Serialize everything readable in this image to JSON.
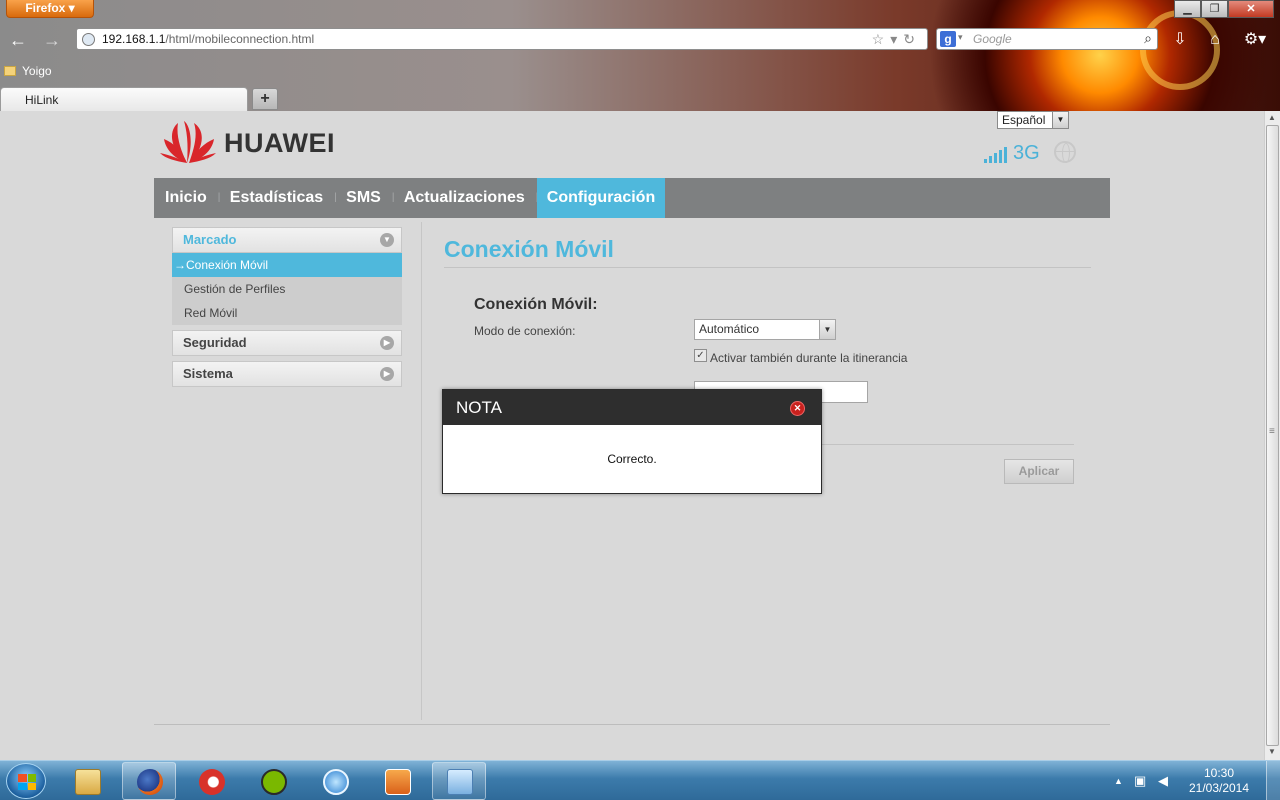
{
  "browser": {
    "app_button": "Firefox",
    "url_host": "192.168.1.1",
    "url_path": "/html/mobileconnection.html",
    "search_placeholder": "Google",
    "bookmarks": [
      "Yoigo"
    ],
    "tabs": [
      {
        "label": "HiLink"
      }
    ],
    "new_tab": "+"
  },
  "page": {
    "language": "Español",
    "brand": "HUAWEI",
    "network_type": "3G",
    "nav": [
      {
        "label": "Inicio"
      },
      {
        "label": "Estadísticas"
      },
      {
        "label": "SMS"
      },
      {
        "label": "Actualizaciones"
      },
      {
        "label": "Configuración",
        "active": true
      }
    ],
    "sidebar": {
      "sections": [
        {
          "label": "Marcado",
          "open": true,
          "items": [
            {
              "label": "Conexión Móvil",
              "active": true
            },
            {
              "label": "Gestión de Perfiles"
            },
            {
              "label": "Red Móvil"
            }
          ]
        },
        {
          "label": "Seguridad"
        },
        {
          "label": "Sistema"
        }
      ]
    },
    "content_title": "Conexión Móvil",
    "form": {
      "title": "Conexión Móvil:",
      "mode_label": "Modo de conexión:",
      "mode_value": "Automático",
      "roaming_label": "Activar también durante la itinerancia",
      "roaming_checked": true,
      "apply_label": "Aplicar"
    }
  },
  "dialog": {
    "title": "NOTA",
    "message": "Correcto."
  },
  "taskbar": {
    "time": "10:30",
    "date": "21/03/2014"
  },
  "colors": {
    "accent": "#4fb8dc",
    "nav_bg": "#7e8081",
    "modal_header": "#2e2e2e"
  }
}
